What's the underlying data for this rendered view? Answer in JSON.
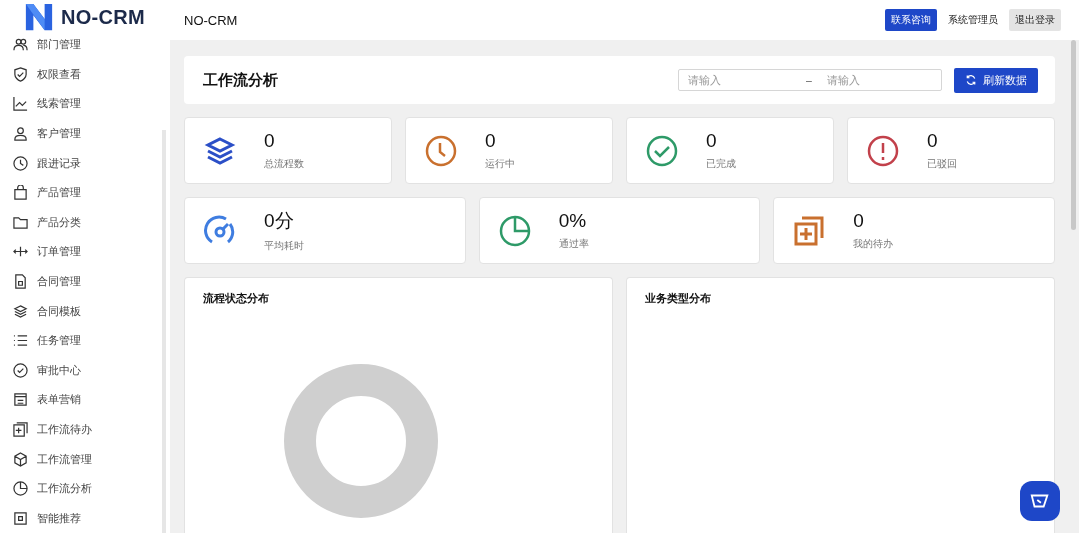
{
  "sidebar": {
    "logo": "NO-CRM",
    "items": [
      {
        "label": "部门管理"
      },
      {
        "label": "权限查看"
      },
      {
        "label": "线索管理"
      },
      {
        "label": "客户管理"
      },
      {
        "label": "跟进记录"
      },
      {
        "label": "产品管理"
      },
      {
        "label": "产品分类"
      },
      {
        "label": "订单管理"
      },
      {
        "label": "合同管理"
      },
      {
        "label": "合同模板"
      },
      {
        "label": "任务管理"
      },
      {
        "label": "审批中心"
      },
      {
        "label": "表单营销"
      },
      {
        "label": "工作流待办"
      },
      {
        "label": "工作流管理"
      },
      {
        "label": "工作流分析"
      },
      {
        "label": "智能推荐"
      }
    ]
  },
  "header": {
    "title": "NO-CRM",
    "contact_button": "联系咨询",
    "user": "系统管理员",
    "logout_button": "退出登录"
  },
  "page": {
    "title": "工作流分析",
    "range": {
      "start_placeholder": "请输入",
      "separator": "–",
      "end_placeholder": "请输入"
    },
    "refresh_button": "刷新数据"
  },
  "stats_row_1": [
    {
      "value": "0",
      "label": "总流程数",
      "color": "#2b4fc7"
    },
    {
      "value": "0",
      "label": "运行中",
      "color": "#c9702e"
    },
    {
      "value": "0",
      "label": "已完成",
      "color": "#2e9a68"
    },
    {
      "value": "0",
      "label": "已驳回",
      "color": "#c2414b"
    }
  ],
  "stats_row_2": [
    {
      "value": "0分",
      "label": "平均耗时",
      "color": "#3f7de0"
    },
    {
      "value": "0%",
      "label": "通过率",
      "color": "#2e9a68"
    },
    {
      "value": "0",
      "label": "我的待办",
      "color": "#c9702e"
    }
  ],
  "panels": [
    {
      "title": "流程状态分布"
    },
    {
      "title": "业务类型分布"
    }
  ]
}
